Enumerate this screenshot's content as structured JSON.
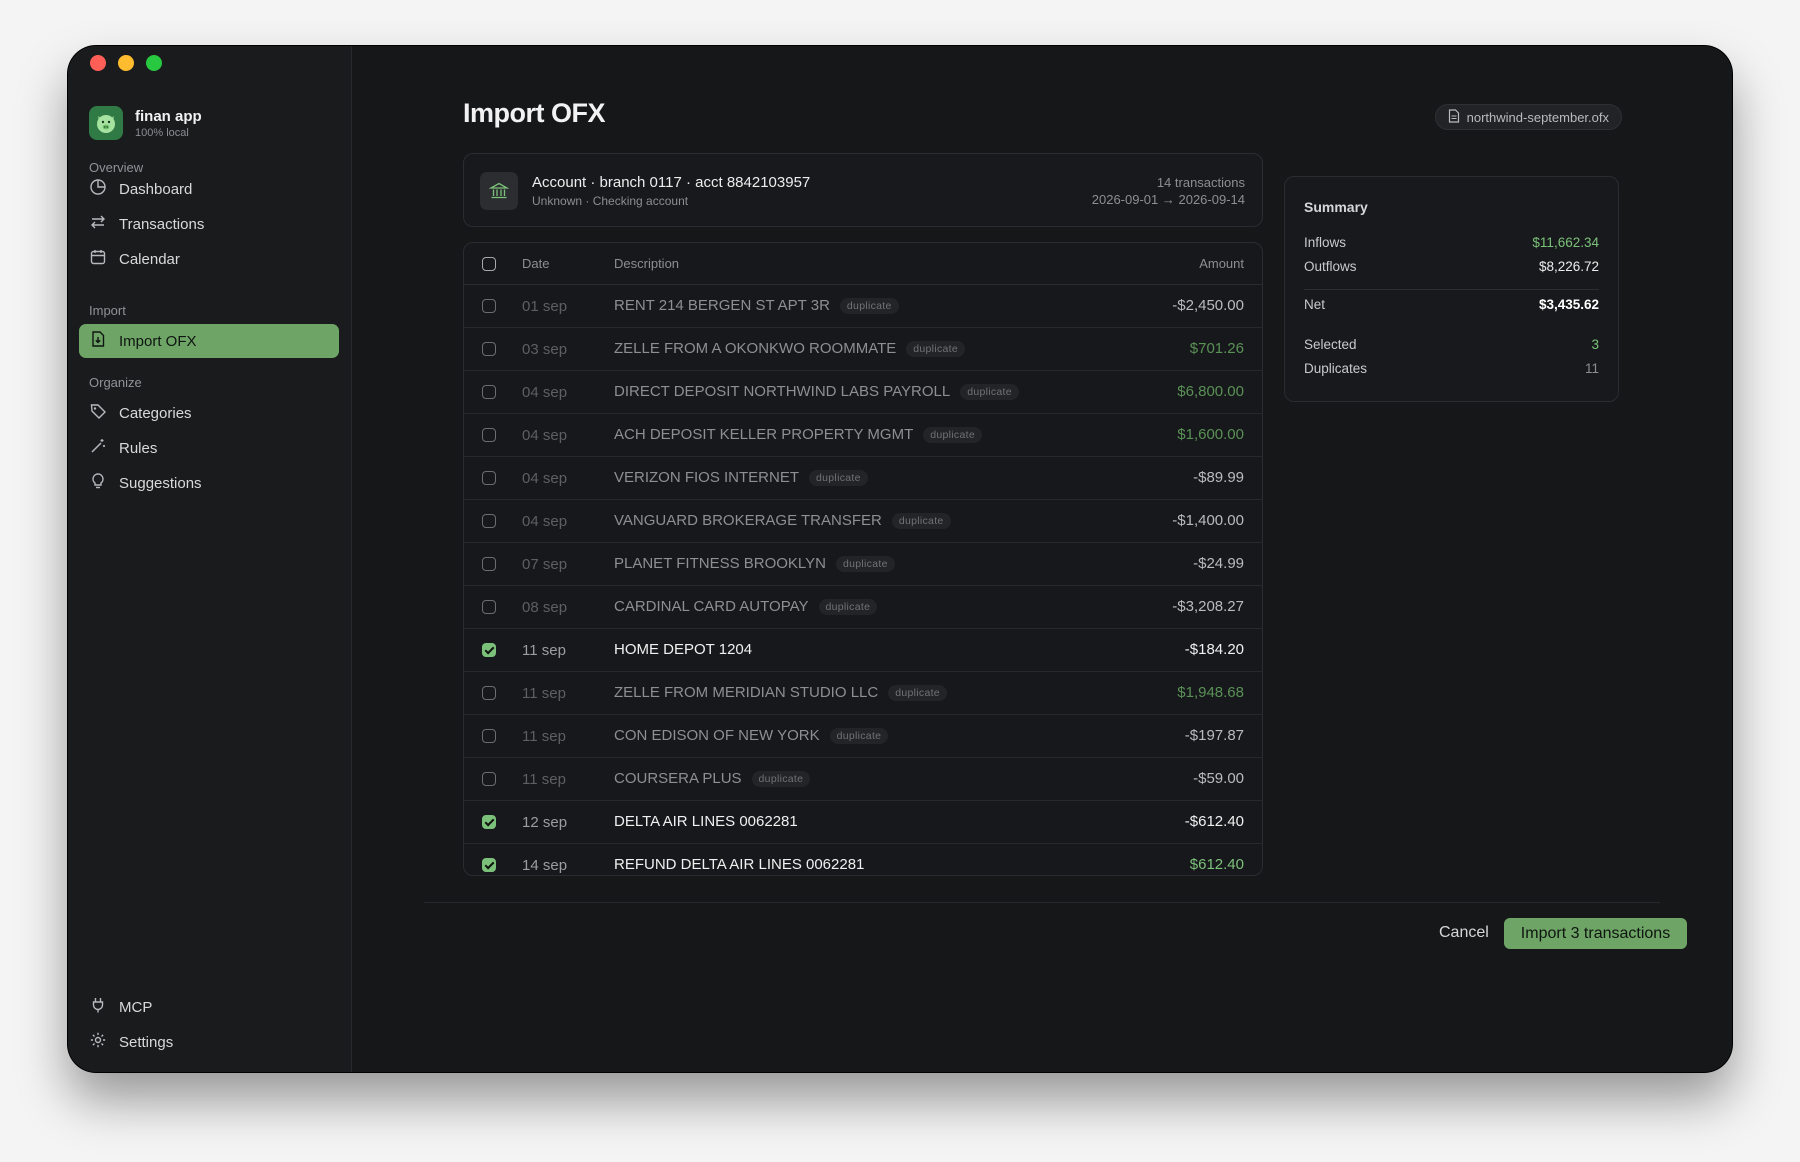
{
  "brand": {
    "name": "finan app",
    "subtitle": "100% local"
  },
  "sidebar": {
    "sections": {
      "overview": "Overview",
      "import": "Import",
      "organize": "Organize"
    },
    "items": {
      "dashboard": "Dashboard",
      "transactions": "Transactions",
      "calendar": "Calendar",
      "import_ofx": "Import OFX",
      "categories": "Categories",
      "rules": "Rules",
      "suggestions": "Suggestions",
      "mcp": "MCP",
      "settings": "Settings"
    },
    "active_item": "import_ofx",
    "accent_color": "#6ea566"
  },
  "header": {
    "title": "Import OFX",
    "file_name": "northwind-september.ofx"
  },
  "account": {
    "title": "Account · branch 0117 · acct 8842103957",
    "subtitle": "Unknown · Checking account",
    "count": "14 transactions",
    "range": "2026-09-01 → 2026-09-14"
  },
  "table": {
    "columns": {
      "date": "Date",
      "description": "Description",
      "amount": "Amount"
    },
    "duplicate_label": "duplicate",
    "rows": [
      {
        "date": "01 sep",
        "description": "RENT 214 BERGEN ST APT 3R",
        "amount": "-$2,450.00",
        "positive": false,
        "duplicate": true,
        "checked": false
      },
      {
        "date": "03 sep",
        "description": "ZELLE FROM A OKONKWO ROOMMATE",
        "amount": "$701.26",
        "positive": true,
        "duplicate": true,
        "checked": false
      },
      {
        "date": "04 sep",
        "description": "DIRECT DEPOSIT NORTHWIND LABS PAYROLL",
        "amount": "$6,800.00",
        "positive": true,
        "duplicate": true,
        "checked": false
      },
      {
        "date": "04 sep",
        "description": "ACH DEPOSIT KELLER PROPERTY MGMT",
        "amount": "$1,600.00",
        "positive": true,
        "duplicate": true,
        "checked": false
      },
      {
        "date": "04 sep",
        "description": "VERIZON FIOS INTERNET",
        "amount": "-$89.99",
        "positive": false,
        "duplicate": true,
        "checked": false
      },
      {
        "date": "04 sep",
        "description": "VANGUARD BROKERAGE TRANSFER",
        "amount": "-$1,400.00",
        "positive": false,
        "duplicate": true,
        "checked": false
      },
      {
        "date": "07 sep",
        "description": "PLANET FITNESS BROOKLYN",
        "amount": "-$24.99",
        "positive": false,
        "duplicate": true,
        "checked": false
      },
      {
        "date": "08 sep",
        "description": "CARDINAL CARD AUTOPAY",
        "amount": "-$3,208.27",
        "positive": false,
        "duplicate": true,
        "checked": false
      },
      {
        "date": "11 sep",
        "description": "HOME DEPOT 1204",
        "amount": "-$184.20",
        "positive": false,
        "duplicate": false,
        "checked": true
      },
      {
        "date": "11 sep",
        "description": "ZELLE FROM MERIDIAN STUDIO LLC",
        "amount": "$1,948.68",
        "positive": true,
        "duplicate": true,
        "checked": false
      },
      {
        "date": "11 sep",
        "description": "CON EDISON OF NEW YORK",
        "amount": "-$197.87",
        "positive": false,
        "duplicate": true,
        "checked": false
      },
      {
        "date": "11 sep",
        "description": "COURSERA PLUS",
        "amount": "-$59.00",
        "positive": false,
        "duplicate": true,
        "checked": false
      },
      {
        "date": "12 sep",
        "description": "DELTA AIR LINES 0062281",
        "amount": "-$612.40",
        "positive": false,
        "duplicate": false,
        "checked": true
      },
      {
        "date": "14 sep",
        "description": "REFUND DELTA AIR LINES 0062281",
        "amount": "$612.40",
        "positive": true,
        "duplicate": false,
        "checked": true
      }
    ]
  },
  "summary": {
    "title": "Summary",
    "inflows_label": "Inflows",
    "inflows_value": "$11,662.34",
    "outflows_label": "Outflows",
    "outflows_value": "$8,226.72",
    "net_label": "Net",
    "net_value": "$3,435.62",
    "selected_label": "Selected",
    "selected_value": "3",
    "duplicates_label": "Duplicates",
    "duplicates_value": "11"
  },
  "footer": {
    "cancel_label": "Cancel",
    "import_label": "Import 3 transactions"
  },
  "colors": {
    "positive": "#7cc17a",
    "accent": "#6ea566",
    "background": "#161719"
  },
  "icons": {
    "brand": "pig-icon",
    "file": "document-icon",
    "account": "bank-icon",
    "dashboard": "pie-chart-icon",
    "transactions": "arrows-swap-icon",
    "calendar": "calendar-icon",
    "import_ofx": "file-import-icon",
    "categories": "tag-icon",
    "rules": "wand-icon",
    "suggestions": "lightbulb-icon",
    "mcp": "plug-icon",
    "settings": "gear-icon"
  }
}
